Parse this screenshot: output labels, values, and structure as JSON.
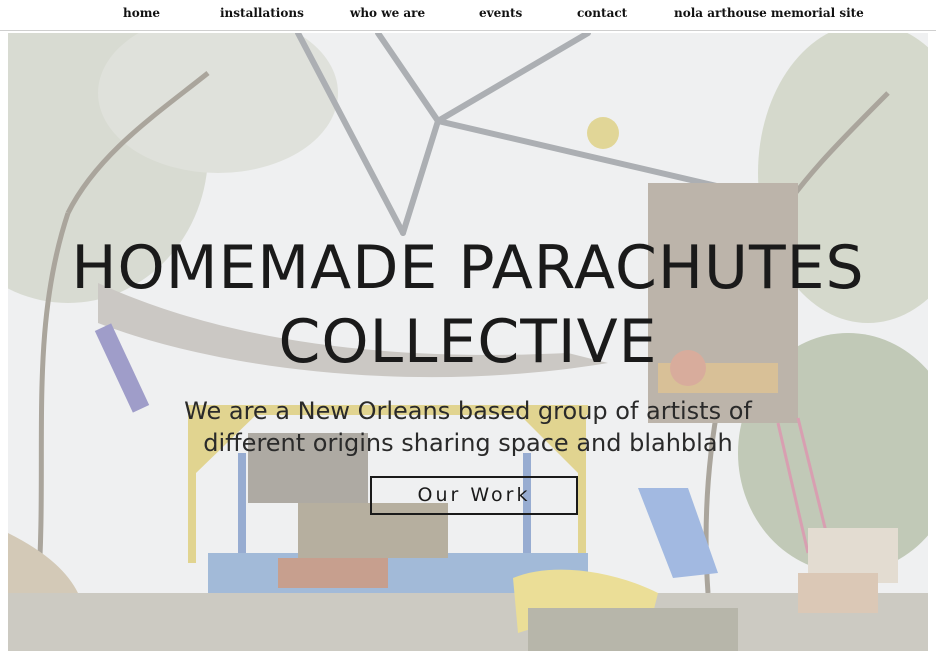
{
  "nav": {
    "home": "home",
    "installations": "installations",
    "who_we_are": "who we are",
    "events": "events",
    "contact": "contact",
    "memorial": "nola arthouse memorial site"
  },
  "hero": {
    "title_line1": "HOMEMADE PARACHUTES",
    "title_line2": "COLLECTIVE",
    "subtitle_line1": "We are a New Orleans based group of artists of",
    "subtitle_line2": "different origins sharing space and blahblah",
    "cta_label": "Our Work"
  },
  "colors": {
    "text": "#1a1a1a",
    "nav_border": "#cfcfcf",
    "image_tint": "#e6e8e6"
  },
  "icons": {
    "hero_image": "backyard-art-installation-photo"
  }
}
